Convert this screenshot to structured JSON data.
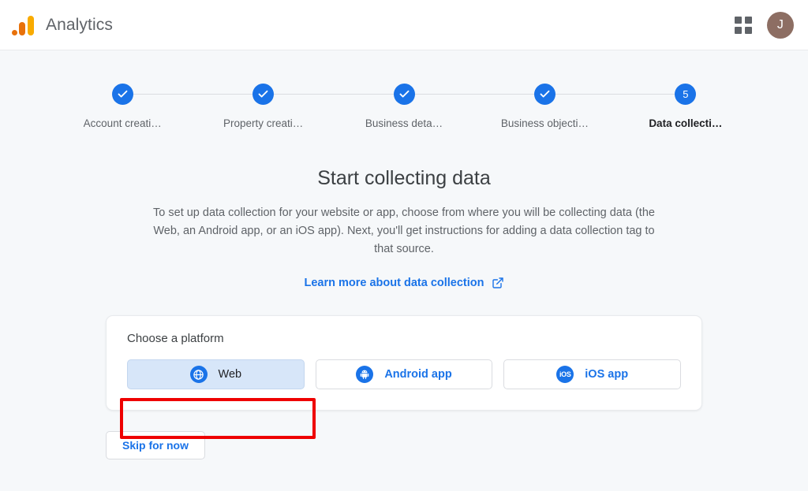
{
  "header": {
    "brand_title": "Analytics",
    "logo_icon": "google-analytics-logo",
    "apps_icon": "apps-grid-icon",
    "avatar_initial": "J",
    "avatar_color": "#8d6e63"
  },
  "stepper": {
    "steps": [
      {
        "label": "Account creati…",
        "state": "complete",
        "indicator": "check"
      },
      {
        "label": "Property creati…",
        "state": "complete",
        "indicator": "check"
      },
      {
        "label": "Business deta…",
        "state": "complete",
        "indicator": "check"
      },
      {
        "label": "Business objecti…",
        "state": "complete",
        "indicator": "check"
      },
      {
        "label": "Data collecti…",
        "state": "current",
        "indicator": "5"
      }
    ],
    "active_color": "#1a73e8",
    "connector_color": "#dadce0"
  },
  "main": {
    "title": "Start collecting data",
    "description": "To set up data collection for your website or app, choose from where you will be collecting data (the Web, an Android app, or an iOS app). Next, you'll get instructions for adding a data collection tag to that source.",
    "learn_more_label": "Learn more about data collection",
    "learn_more_icon": "external-link-icon",
    "link_color": "#1a73e8"
  },
  "platform_card": {
    "heading": "Choose a platform",
    "options": [
      {
        "label": "Web",
        "icon": "globe-icon",
        "selected": true
      },
      {
        "label": "Android app",
        "icon": "android-icon",
        "selected": false
      },
      {
        "label": "iOS app",
        "icon": "ios-icon",
        "icon_text": "iOS",
        "selected": false
      }
    ],
    "selected_bg": "#d7e6f9"
  },
  "footer": {
    "skip_label": "Skip for now"
  },
  "annotation": {
    "color": "#ee0000",
    "target": "Web"
  }
}
